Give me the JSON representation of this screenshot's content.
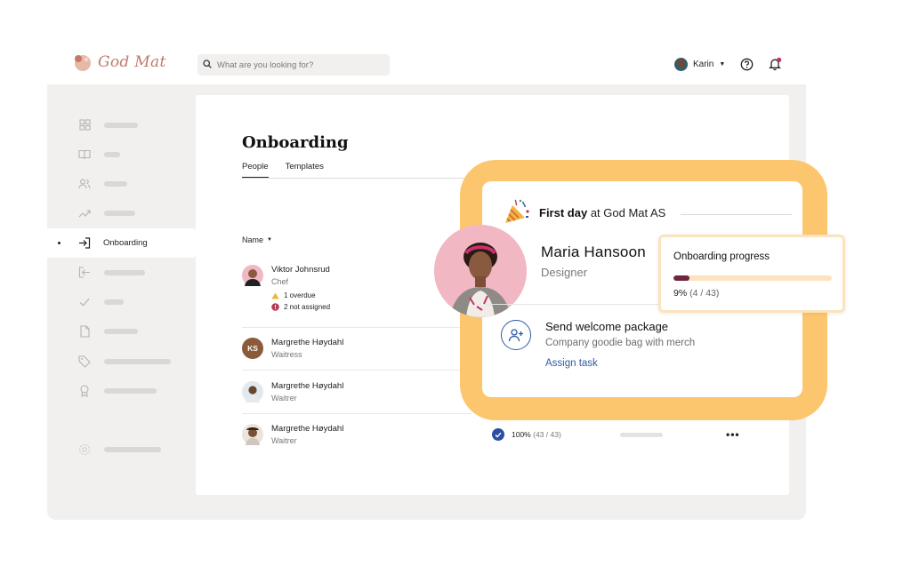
{
  "app": {
    "brand": "God Mat",
    "search_placeholder": "What are you looking for?",
    "user_name": "Karin"
  },
  "sidebar": {
    "active_label": "Onboarding",
    "items": [
      {
        "icon": "grid-icon"
      },
      {
        "icon": "book-icon"
      },
      {
        "icon": "people-icon"
      },
      {
        "icon": "trend-icon"
      },
      {
        "icon": "enter-icon",
        "label": "Onboarding",
        "active": true
      },
      {
        "icon": "exit-icon"
      },
      {
        "icon": "check-icon"
      },
      {
        "icon": "document-icon"
      },
      {
        "icon": "tag-icon"
      },
      {
        "icon": "award-icon"
      },
      {
        "icon": "settings-icon"
      }
    ]
  },
  "page": {
    "title": "Onboarding",
    "tabs": [
      {
        "label": "People",
        "active": true
      },
      {
        "label": "Templates",
        "active": false
      }
    ],
    "column_name": "Name"
  },
  "people": [
    {
      "name": "Viktor Johnsrud",
      "role": "Chef",
      "overdue": "1 overdue",
      "not_assigned": "2 not assigned"
    },
    {
      "name": "Margrethe Høydahl",
      "role": "Waitress",
      "initials": "KS"
    },
    {
      "name": "Margrethe Høydahl",
      "role": "Waitrer"
    },
    {
      "name": "Margrethe Høydahl",
      "role": "Waitrer",
      "progress_pct": "100%",
      "progress_count": "(43 / 43)"
    }
  ],
  "feature": {
    "first_day_bold": "First day",
    "first_day_rest": "at God Mat AS",
    "employee_name": "Maria Hansoon",
    "employee_role": "Designer",
    "task_title": "Send welcome package",
    "task_desc": "Company goodie bag with merch",
    "task_link": "Assign task",
    "progress_title": "Onboarding progress",
    "progress_pct": "9%",
    "progress_count": "(4 / 43)",
    "progress_fraction": 0.09
  },
  "colors": {
    "accent_blue": "#2d5aa8",
    "halo": "#fcc66e",
    "progress_fill": "#6d2540",
    "brand": "#c07a6a"
  }
}
